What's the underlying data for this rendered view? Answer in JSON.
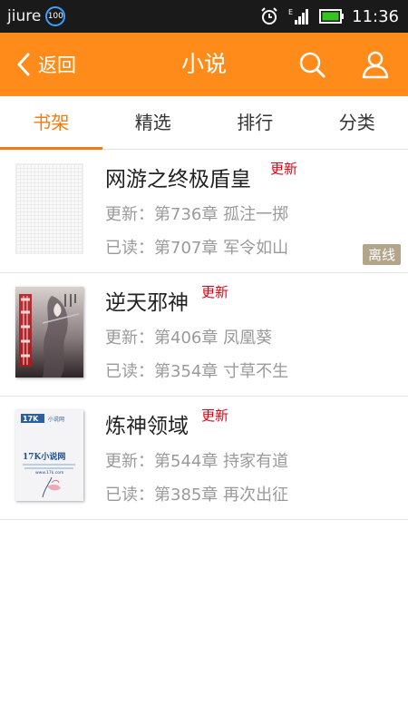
{
  "status_bar": {
    "carrier": "jiure",
    "badge": "100",
    "time": "11:36",
    "icons": [
      "alarm-icon",
      "signal-icon",
      "battery-icon"
    ]
  },
  "header": {
    "back_label": "返回",
    "title": "小说",
    "icons": [
      "search-icon",
      "user-icon"
    ],
    "color": "#ff8c1a"
  },
  "tabs": [
    {
      "label": "书架",
      "active": true
    },
    {
      "label": "精选",
      "active": false
    },
    {
      "label": "排行",
      "active": false
    },
    {
      "label": "分类",
      "active": false
    }
  ],
  "colors": {
    "accent": "#f07d12",
    "new_badge": "#e60012",
    "offline_badge": "#b3a58a"
  },
  "books": [
    {
      "title": "网游之终极盾皇",
      "new_badge": "更新",
      "update": "更新：第736章 孤注一掷",
      "read": "已读：第707章 军令如山",
      "offline": "离线"
    },
    {
      "title": "逆天邪神",
      "new_badge": "更新",
      "update": "更新：第406章 凤凰葵",
      "read": "已读：第354章 寸草不生"
    },
    {
      "title": "炼神领域",
      "new_badge": "更新",
      "update": "更新：第544章 持家有道",
      "read": "已读：第385章 再次出征",
      "cover_text": {
        "logo": "17K",
        "logo_sub": "小说网",
        "name": "17K小说网",
        "url": "www.17k.com"
      }
    }
  ]
}
